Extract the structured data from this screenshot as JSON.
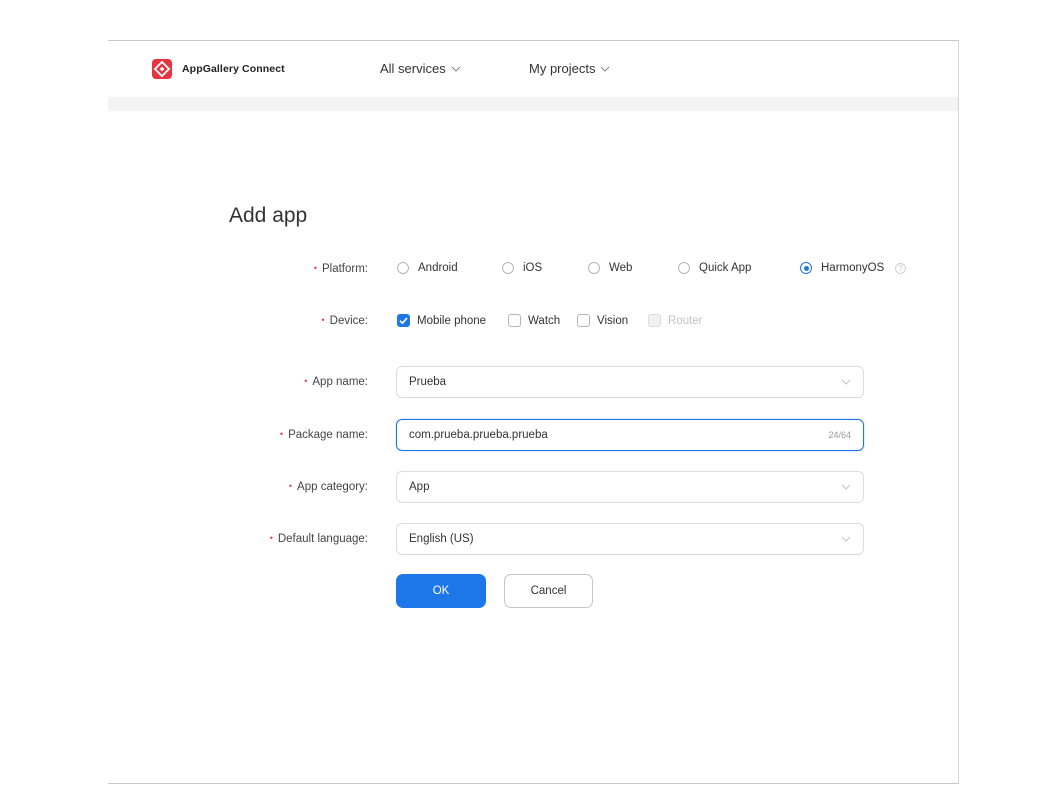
{
  "header": {
    "brand": "AppGallery Connect",
    "nav": [
      {
        "label": "All services"
      },
      {
        "label": "My projects"
      }
    ]
  },
  "form": {
    "title": "Add app",
    "platform": {
      "label": "Platform:",
      "options": [
        {
          "label": "Android",
          "selected": false
        },
        {
          "label": "iOS",
          "selected": false
        },
        {
          "label": "Web",
          "selected": false
        },
        {
          "label": "Quick App",
          "selected": false
        },
        {
          "label": "HarmonyOS",
          "selected": true
        }
      ]
    },
    "device": {
      "label": "Device:",
      "options": [
        {
          "label": "Mobile phone",
          "checked": true,
          "disabled": false
        },
        {
          "label": "Watch",
          "checked": false,
          "disabled": false
        },
        {
          "label": "Vision",
          "checked": false,
          "disabled": false
        },
        {
          "label": "Router",
          "checked": false,
          "disabled": true
        }
      ]
    },
    "app_name": {
      "label": "App name:",
      "value": "Prueba"
    },
    "package_name": {
      "label": "Package name:",
      "value": "com.prueba.prueba.prueba",
      "counter": "24/64"
    },
    "app_category": {
      "label": "App category:",
      "value": "App"
    },
    "default_language": {
      "label": "Default language:",
      "value": "English (US)"
    },
    "ok_label": "OK",
    "cancel_label": "Cancel"
  },
  "colors": {
    "accent": "#1e77e8",
    "required": "#e54545",
    "brand": "#e8343f"
  }
}
